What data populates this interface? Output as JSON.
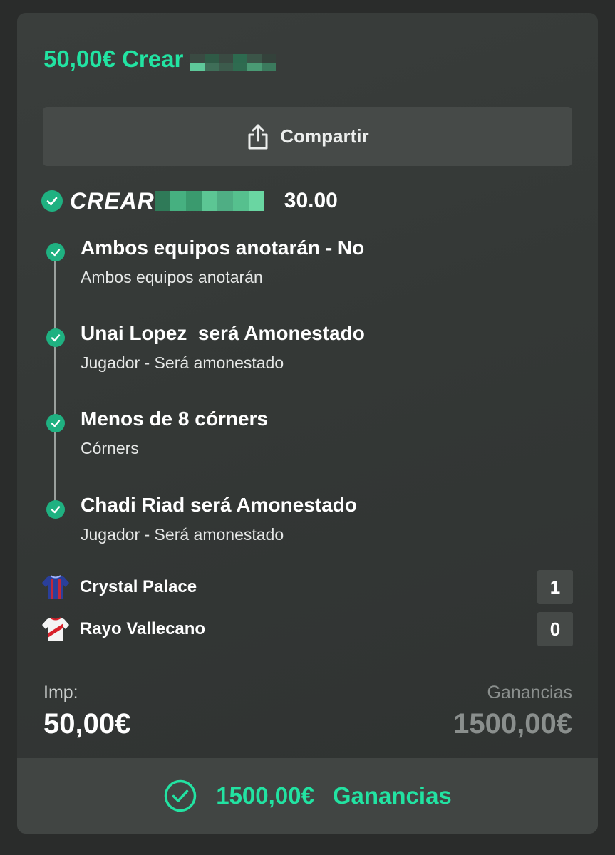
{
  "header": {
    "amount_text": "50,00€ Crear"
  },
  "share": {
    "label": "Compartir"
  },
  "bet": {
    "brand": "CREAR",
    "odds": "30.00"
  },
  "selections": [
    {
      "title": "Ambos equipos anotarán - No",
      "market": "Ambos equipos anotarán"
    },
    {
      "title": "Unai Lopez  será Amonestado",
      "market": "Jugador - Será amonestado"
    },
    {
      "title": "Menos de 8 córners",
      "market": "Córners"
    },
    {
      "title": "Chadi Riad será Amonestado",
      "market": "Jugador - Será amonestado"
    }
  ],
  "teams": [
    {
      "name": "Crystal Palace",
      "score": "1"
    },
    {
      "name": "Rayo Vallecano",
      "score": "0"
    }
  ],
  "stake": {
    "label": "Imp:",
    "value": "50,00€"
  },
  "winnings": {
    "label": "Ganancias",
    "value": "1500,00€"
  },
  "footer": {
    "amount": "1500,00€",
    "label": "Ganancias"
  },
  "colors": {
    "accent": "#22e3a2",
    "check": "#1fb181",
    "card_bg": "#363a38",
    "page_bg": "#2a2c2b"
  }
}
